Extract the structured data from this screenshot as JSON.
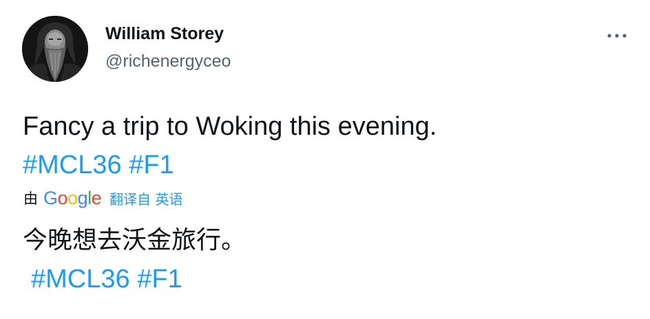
{
  "author": {
    "display_name": "William Storey",
    "handle": "@richenergyceo"
  },
  "tweet": {
    "text": "Fancy a trip to Woking this evening.",
    "hashtags": [
      "#MCL36",
      "#F1"
    ]
  },
  "translation": {
    "by_label": "由",
    "provider": "Google",
    "link_text": "翻译自 英语",
    "text": "今晚想去沃金旅行。",
    "hashtags": [
      "#MCL36",
      "#F1"
    ]
  },
  "icons": {
    "more": "more-horizontal-icon",
    "avatar": "profile-photo"
  },
  "colors": {
    "link": "#1d9bf0",
    "text": "#0f1419",
    "secondary": "#536471",
    "google_blue": "#4285f4",
    "google_red": "#ea4335",
    "google_yellow": "#fbbc05",
    "google_green": "#34a853"
  }
}
